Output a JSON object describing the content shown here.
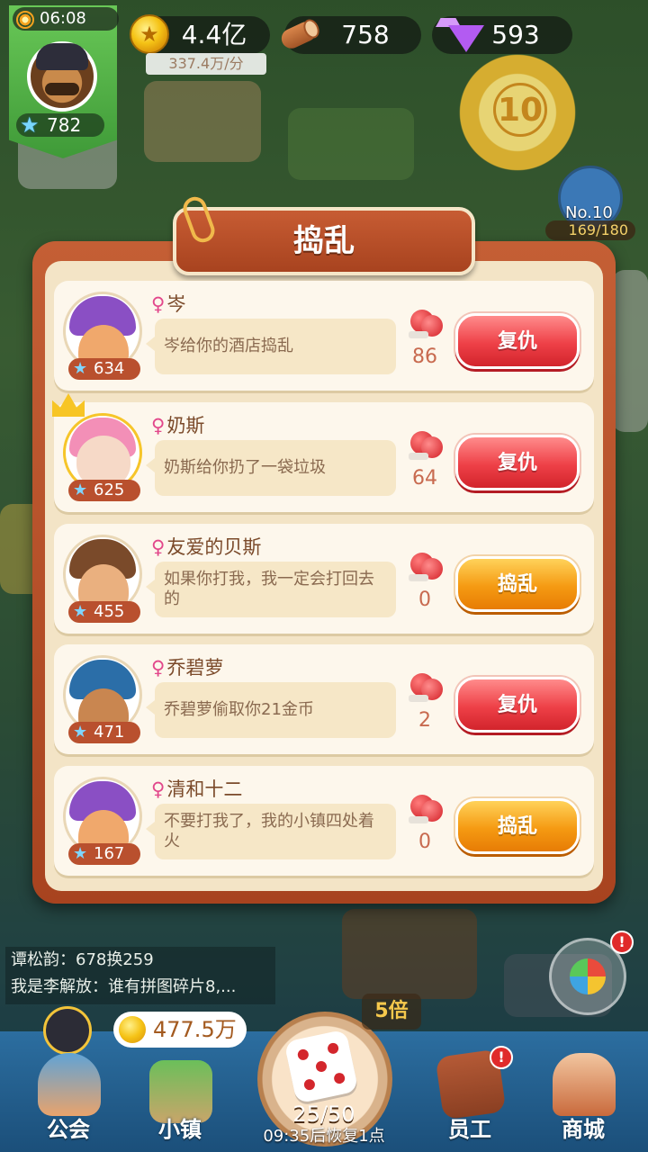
{
  "hud": {
    "time": "06:08",
    "player_level": "782",
    "coins": "4.4亿",
    "coin_rate": "337.4万/分",
    "wood": "758",
    "gems": "593"
  },
  "rank": {
    "trophy_number": "10",
    "rank_label": "No.10",
    "progress": "169/180"
  },
  "modal": {
    "title": "捣乱",
    "rows": [
      {
        "name": "岑",
        "level": "634",
        "message": "岑给你的酒店捣乱",
        "count": "86",
        "button": "复仇",
        "button_type": "revenge"
      },
      {
        "name": "奶斯",
        "level": "625",
        "message": "奶斯给你扔了一袋垃圾",
        "count": "64",
        "button": "复仇",
        "button_type": "revenge"
      },
      {
        "name": "友爱的贝斯",
        "level": "455",
        "message": "如果你打我，我一定会打回去的",
        "count": "0",
        "button": "捣乱",
        "button_type": "mess"
      },
      {
        "name": "乔碧萝",
        "level": "471",
        "message": "乔碧萝偷取你21金币",
        "count": "2",
        "button": "复仇",
        "button_type": "revenge"
      },
      {
        "name": "清和十二",
        "level": "167",
        "message": "不要打我了，我的小镇四处着火",
        "count": "0",
        "button": "捣乱",
        "button_type": "mess"
      }
    ]
  },
  "chat": {
    "lines": [
      "谭松韵：678换259",
      "我是李解放：谁有拼图碎片8,..."
    ]
  },
  "bottom": {
    "town_coins": "477.5万",
    "multiplier": "5倍",
    "dice_count": "25/50",
    "dice_timer": "09:35后恢复1点",
    "nav": [
      {
        "label": "公会"
      },
      {
        "label": "小镇"
      },
      {
        "label": "员工"
      },
      {
        "label": "商城"
      }
    ],
    "staff_alert": "!"
  },
  "colors": {
    "revenge_button": "#ee4047",
    "mess_button": "#f59a12",
    "modal_frame": "#b14b25",
    "modal_bg": "#f3e4c6"
  }
}
